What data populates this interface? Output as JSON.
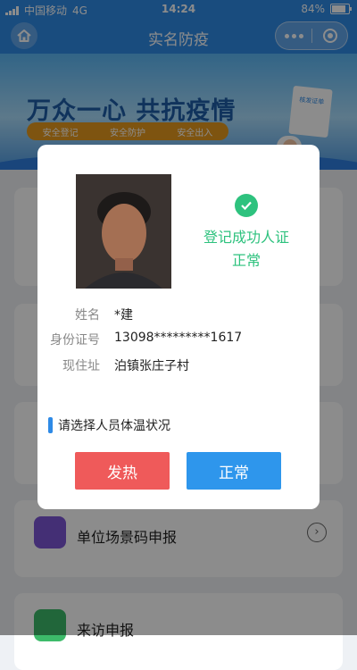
{
  "status_bar": {
    "carrier": "中国移动",
    "network": "4G",
    "time": "14:24",
    "battery": "84%"
  },
  "nav": {
    "title": "实名防疫"
  },
  "banner": {
    "slogan": "万众一心  共抗疫情",
    "chips": [
      "安全登记",
      "安全防护",
      "安全出入"
    ],
    "doc_text": "核发证单"
  },
  "menu": {
    "venue_label": "单位场景码申报",
    "arrival_label": "来访申报"
  },
  "modal": {
    "status_line1": "登记成功人证",
    "status_line2": "正常",
    "info": [
      {
        "key": "姓名",
        "value": "*建"
      },
      {
        "key": "身份证号",
        "value": "13098*********1617"
      },
      {
        "key": "现住址",
        "value": "泊镇张庄子村"
      }
    ],
    "temp_prompt": "请选择人员体温状况",
    "buttons": {
      "fever": "发热",
      "normal": "正常"
    }
  },
  "colors": {
    "primary": "#2e8ae6",
    "success": "#2ec27e",
    "danger": "#ef5a5a"
  }
}
